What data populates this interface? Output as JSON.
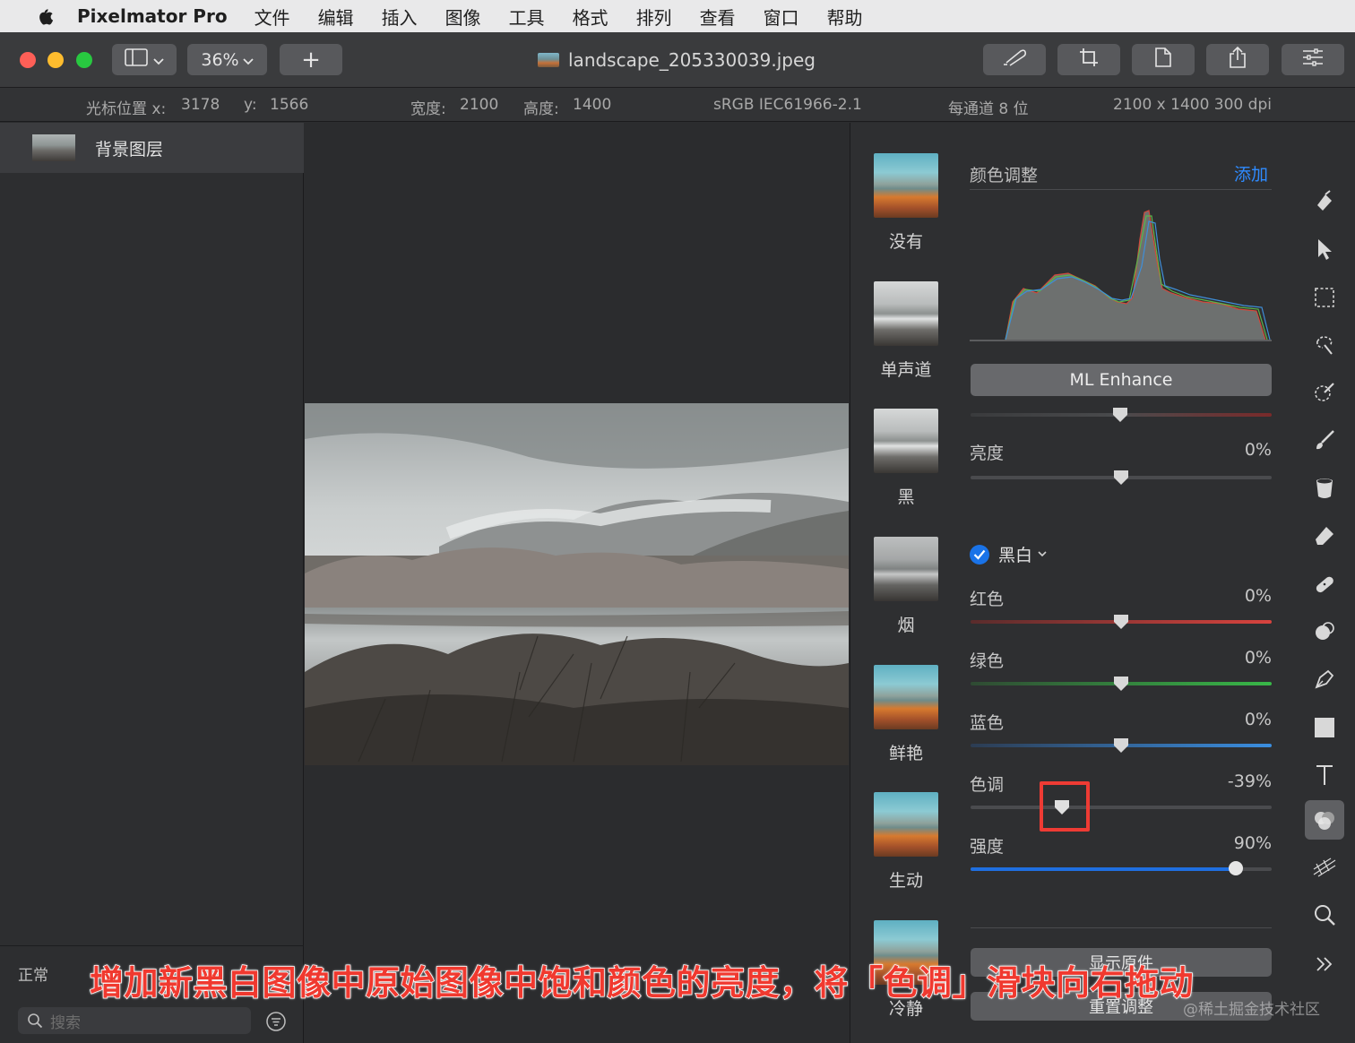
{
  "menubar": {
    "app_name": "Pixelmator Pro",
    "items": [
      "文件",
      "编辑",
      "插入",
      "图像",
      "工具",
      "格式",
      "排列",
      "查看",
      "窗口",
      "帮助"
    ]
  },
  "toolbar": {
    "zoom": "36%",
    "add_symbol": "+",
    "document_title": "landscape_205330039.jpeg",
    "icons": [
      "sidebar-icon",
      "chevron-down-icon",
      "plus-icon",
      "brush-icon",
      "crop-icon",
      "document-icon",
      "share-icon",
      "sliders-icon"
    ]
  },
  "infobar": {
    "cursor_label": "光标位置 x:",
    "cursor_x": "3178",
    "cursor_y_label": "y:",
    "cursor_y": "1566",
    "width_label": "宽度:",
    "width": "2100",
    "height_label": "高度:",
    "height": "1400",
    "profile": "sRGB IEC61966-2.1",
    "bits": "每通道 8 位",
    "resolution": "2100 x 1400 300 dpi"
  },
  "layers": {
    "items": [
      {
        "name": "背景图层"
      }
    ],
    "blend_mode": "正常",
    "search_placeholder": "搜索"
  },
  "presets": {
    "items": [
      {
        "label": "没有",
        "style": "color"
      },
      {
        "label": "单声道",
        "style": "bw"
      },
      {
        "label": "黑",
        "style": "bw"
      },
      {
        "label": "烟",
        "style": "bw"
      },
      {
        "label": "鲜艳",
        "style": "color"
      },
      {
        "label": "生动",
        "style": "color"
      },
      {
        "label": "冷静",
        "style": "color"
      }
    ]
  },
  "adjust": {
    "title": "颜色调整",
    "add_label": "添加",
    "ml_enhance": "ML Enhance",
    "brightness": {
      "label": "亮度",
      "value": "0%",
      "level": 0.5
    },
    "bw": {
      "label": "黑白",
      "checked": true
    },
    "red": {
      "label": "红色",
      "value": "0%",
      "level": 0.5
    },
    "green": {
      "label": "绿色",
      "value": "0%",
      "level": 0.5
    },
    "blue": {
      "label": "蓝色",
      "value": "0%",
      "level": 0.5
    },
    "tone": {
      "label": "色调",
      "value": "-39%",
      "level": 0.305
    },
    "intensity": {
      "label": "强度",
      "value": "90%",
      "level": 0.88
    },
    "show_original": "显示原件",
    "reset": "重置调整"
  },
  "tools": [
    "paint-bucket-icon",
    "arrow-icon",
    "marquee-icon",
    "lasso-icon",
    "magic-wand-icon",
    "brush-icon",
    "fill-icon",
    "eraser-icon",
    "bandage-icon",
    "clone-icon",
    "pen-icon",
    "rectangle-icon",
    "text-icon",
    "color-adjust-icon",
    "distort-icon",
    "zoom-icon",
    "more-icon"
  ],
  "caption": "增加新黑白图像中原始图像中饱和颜色的亮度，将「色调」滑块向右拖动",
  "watermark": "@稀土掘金技术社区",
  "colors": {
    "accent": "#2e8bff",
    "highlight": "#ee3b34",
    "caption": "#f0392f"
  }
}
